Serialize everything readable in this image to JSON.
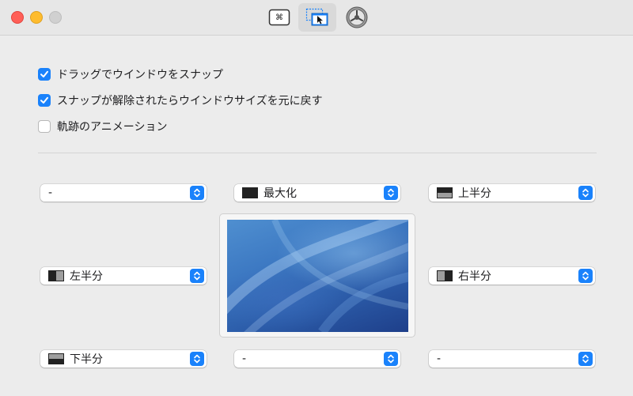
{
  "toolbar": {
    "tabs": [
      {
        "name": "keyboard-shortcuts",
        "icon": "command-key-icon"
      },
      {
        "name": "snap-areas",
        "icon": "window-snap-icon",
        "selected": true
      },
      {
        "name": "advanced",
        "icon": "settings-gear-icon"
      }
    ],
    "keys_glyph": "⌘"
  },
  "options": {
    "snap_by_drag": {
      "label": "ドラッグでウインドウをスナップ",
      "checked": true
    },
    "restore_size": {
      "label": "スナップが解除されたらウインドウサイズを元に戻す",
      "checked": true
    },
    "animate_footprint": {
      "label": "軌跡のアニメーション",
      "checked": false
    }
  },
  "snap_areas": {
    "top_left": {
      "value": "-"
    },
    "top": {
      "value": "最大化",
      "swatch": "full"
    },
    "top_right": {
      "value": "上半分",
      "swatch": "top-half"
    },
    "left": {
      "value": "左半分",
      "swatch": "left-half"
    },
    "right": {
      "value": "右半分",
      "swatch": "right-half"
    },
    "bottom_left": {
      "value": "下半分",
      "swatch": "bottom-half"
    },
    "bottom": {
      "value": "-"
    },
    "bottom_right": {
      "value": "-"
    }
  },
  "colors": {
    "accent": "#1a82fb",
    "close": "#ff5f57",
    "minimize": "#febc2e",
    "zoom_disabled": "#d0d0d0"
  }
}
